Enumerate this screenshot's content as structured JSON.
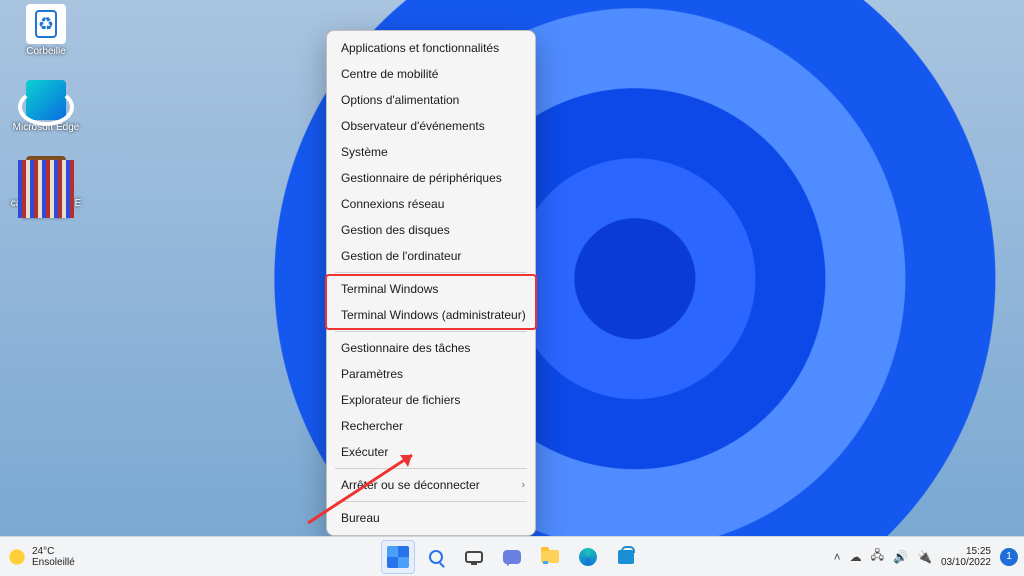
{
  "desktop_icons": [
    {
      "name": "recycle-bin",
      "label": "Corbeille"
    },
    {
      "name": "microsoft-edge",
      "label": "Microsoft Edge"
    },
    {
      "name": "calibre",
      "label": "calibre 64Bit - E Book ma..."
    }
  ],
  "winx_menu": {
    "items": [
      "Applications et fonctionnalités",
      "Centre de mobilité",
      "Options d'alimentation",
      "Observateur d'événements",
      "Système",
      "Gestionnaire de périphériques",
      "Connexions réseau",
      "Gestion des disques",
      "Gestion de l'ordinateur",
      "Terminal Windows",
      "Terminal Windows (administrateur)",
      "Gestionnaire des tâches",
      "Paramètres",
      "Explorateur de fichiers",
      "Rechercher",
      "Exécuter",
      "Arrêter ou se déconnecter",
      "Bureau"
    ],
    "separators_after": [
      8,
      10,
      15,
      16
    ],
    "submenu_at": 16,
    "highlight_range": [
      9,
      10
    ]
  },
  "taskbar": {
    "weather": {
      "temp": "24°C",
      "cond": "Ensoleillé"
    },
    "center": [
      {
        "name": "start",
        "selected": true
      },
      {
        "name": "search",
        "selected": false
      },
      {
        "name": "taskview",
        "selected": false
      },
      {
        "name": "chat",
        "selected": false
      },
      {
        "name": "explorer",
        "selected": false
      },
      {
        "name": "edge",
        "selected": false
      },
      {
        "name": "store",
        "selected": false
      }
    ],
    "tray_icons": [
      "chevron-up-icon",
      "onedrive-icon",
      "network-icon",
      "volume-icon",
      "power-icon"
    ],
    "clock": {
      "time": "15:25",
      "date": "03/10/2022"
    },
    "notifications": "1"
  },
  "annotation": {
    "highlight_color": "#e33333",
    "arrow_from": "lower-left",
    "arrow_to": "start-button"
  }
}
